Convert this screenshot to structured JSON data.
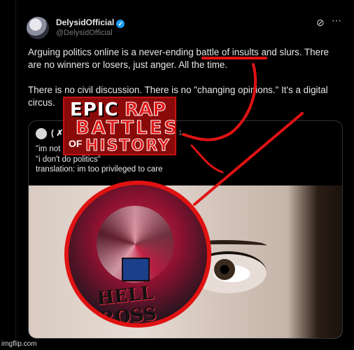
{
  "post": {
    "display_name": "DelysidOfficial",
    "verified_mark": "✓",
    "handle": "@DelysidOfficial",
    "paragraphs": [
      "Arguing politics online is a never-ending battle of insults and slurs. There are no winners or losers, just anger. All the time.",
      "There is no civil discussion. There is no \"changing opinions.\" It's a digital circus."
    ],
    "icons": [
      "grok-icon",
      "more-icon"
    ]
  },
  "quote": {
    "name": "( ✗",
    "date": "1",
    "lines": [
      "\"im not",
      "\"i don't do politics\"",
      "translation: im too privileged to care"
    ]
  },
  "overlay": {
    "erb": {
      "epic": "EPIC",
      "rap": "RAP",
      "battles": "BATTLES",
      "of": "OF",
      "history": "HISTORY"
    },
    "hazbin_title": "HELL BOSS",
    "annotation_color": "#e01212"
  },
  "watermark": "imgflip.com"
}
